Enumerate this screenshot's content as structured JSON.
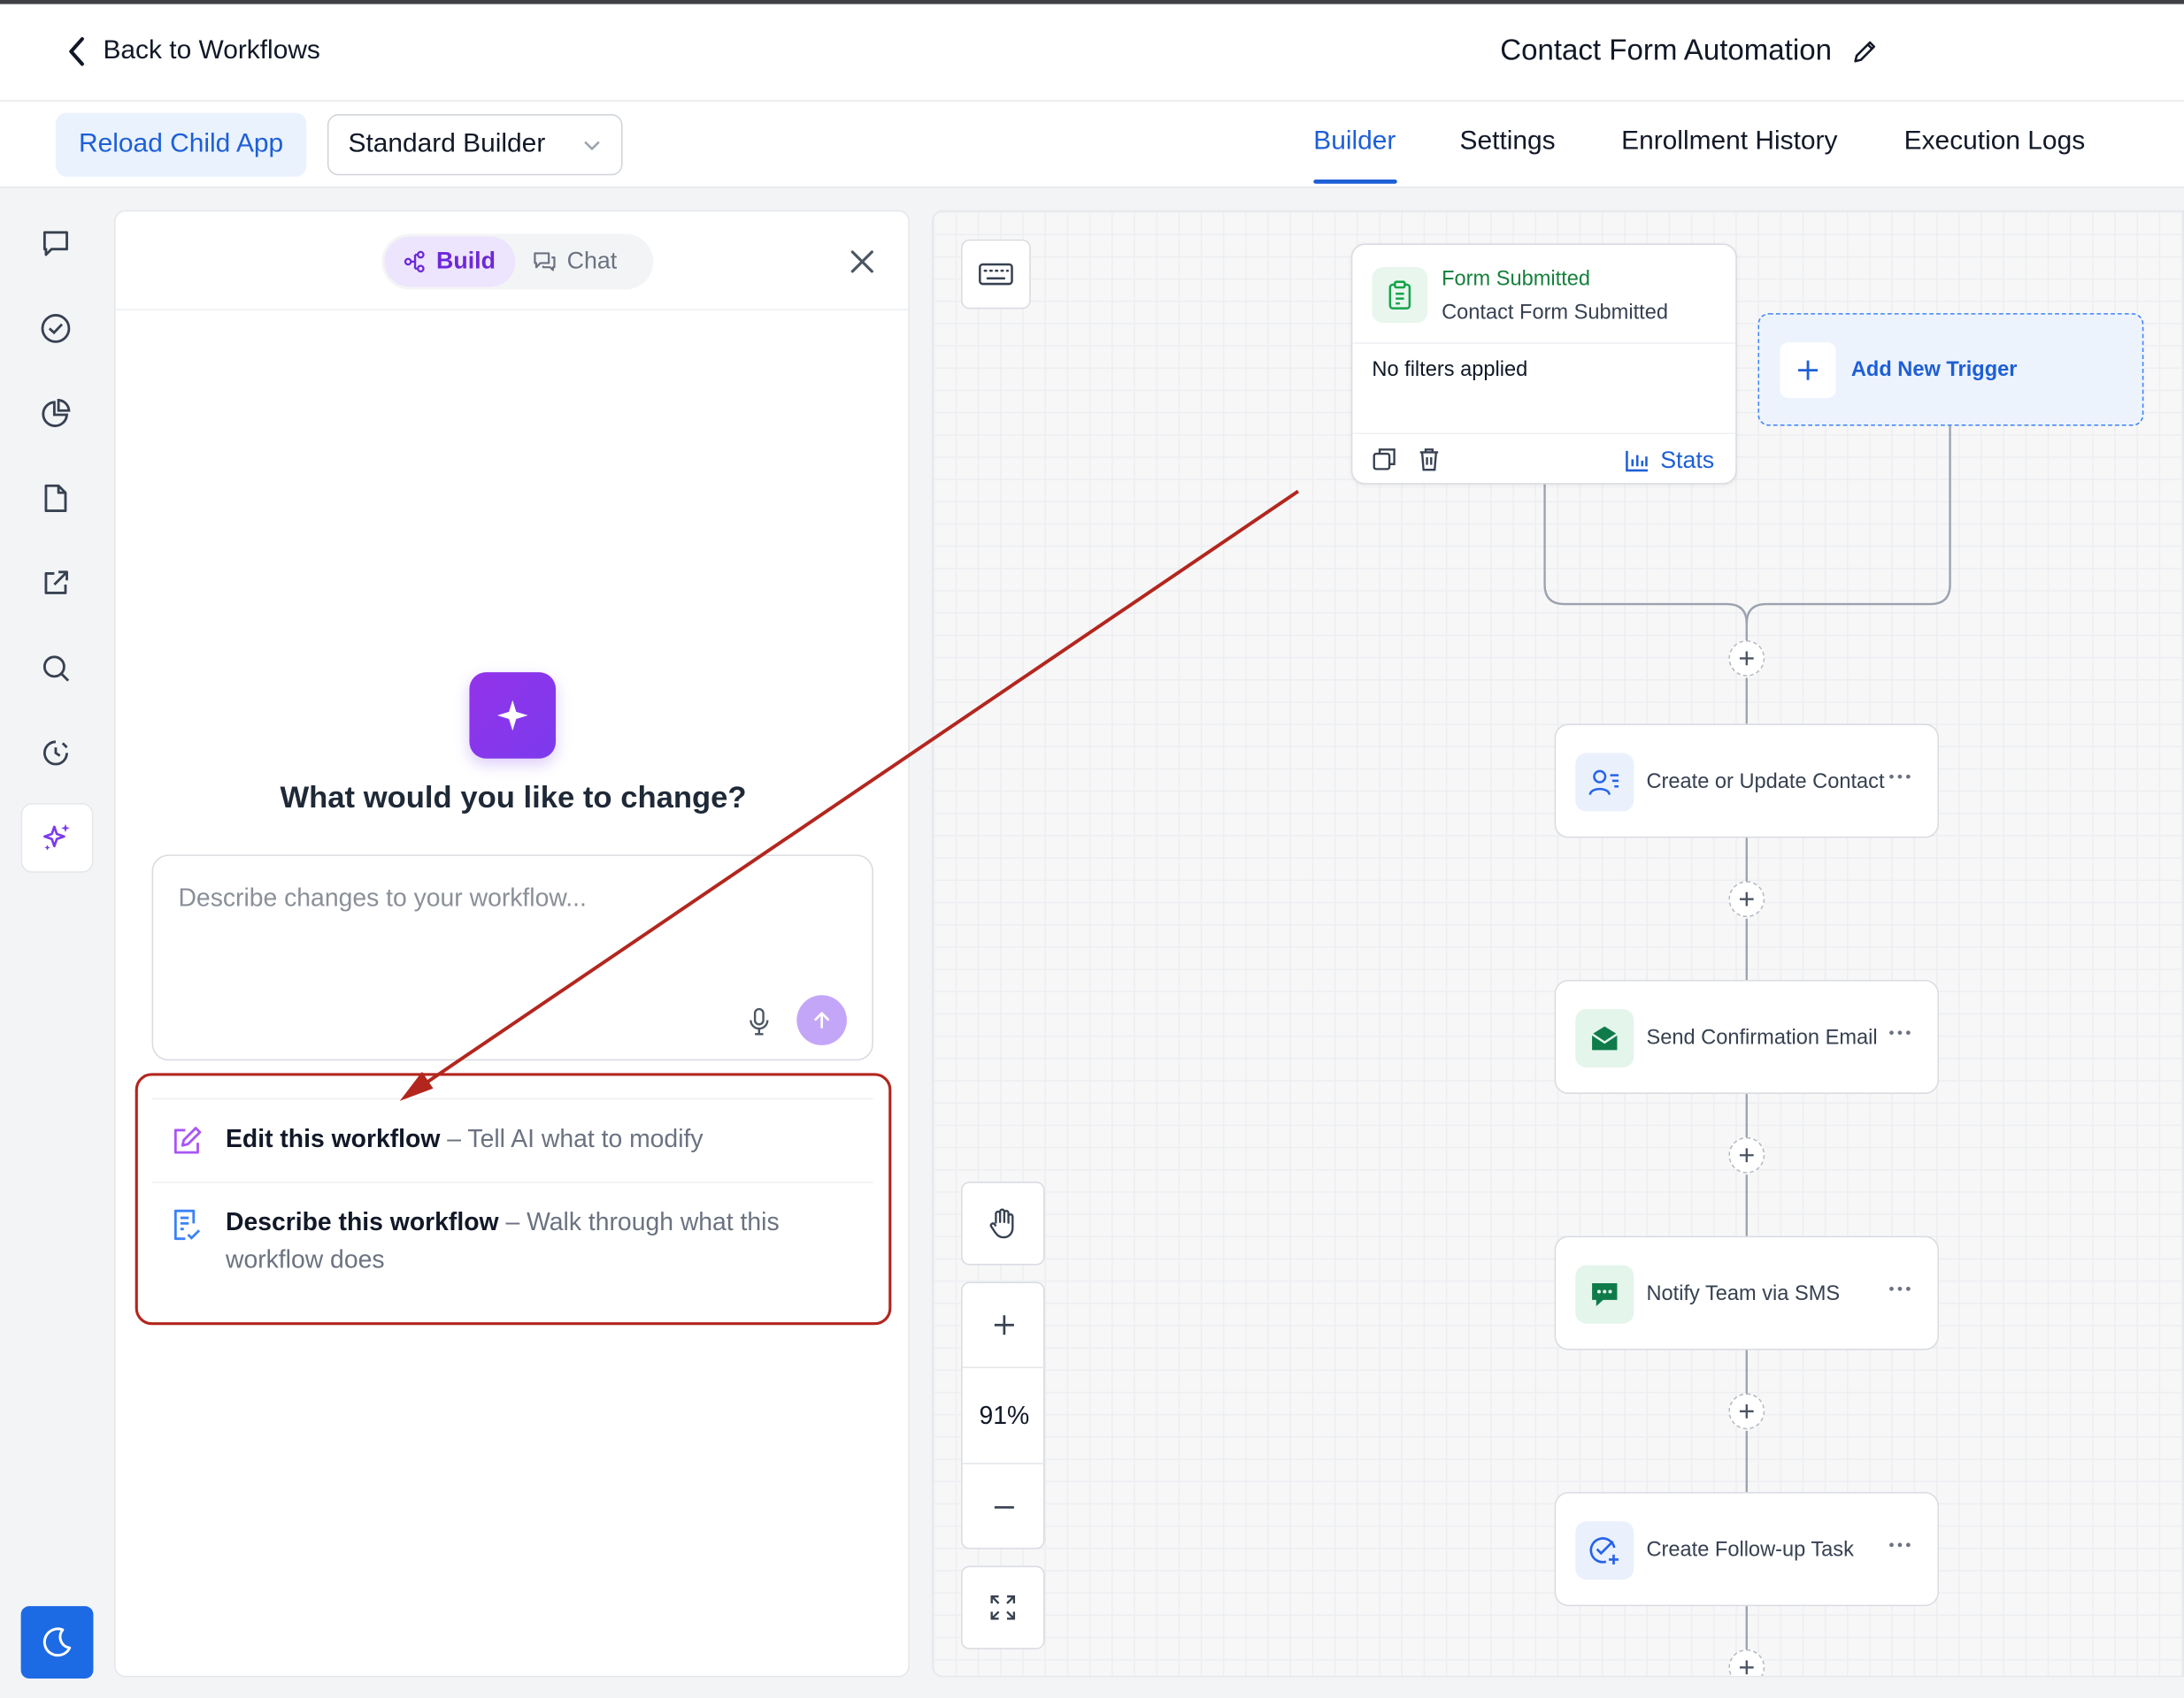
{
  "header": {
    "back_label": "Back to Workflows",
    "workflow_title": "Contact Form Automation"
  },
  "toolbar": {
    "reload_label": "Reload Child App",
    "builder_select": "Standard Builder",
    "tabs": [
      {
        "label": "Builder",
        "active": true
      },
      {
        "label": "Settings",
        "active": false
      },
      {
        "label": "Enrollment History",
        "active": false
      },
      {
        "label": "Execution Logs",
        "active": false
      }
    ]
  },
  "sidebar": {
    "icons": [
      "chat-bubble-icon",
      "check-circle-icon",
      "pie-chart-icon",
      "document-icon",
      "external-link-icon",
      "search-icon",
      "history-icon",
      "ai-sparkles-icon"
    ],
    "theme_toggle_icon": "moon-icon"
  },
  "ai_panel": {
    "build_label": "Build",
    "chat_label": "Chat",
    "question": "What would you like to change?",
    "input_placeholder": "Describe changes to your workflow...",
    "suggestions": [
      {
        "title": "Edit this workflow",
        "desc": " – Tell AI what to modify"
      },
      {
        "title": "Describe this workflow",
        "desc": " – Walk through what this workflow does"
      }
    ]
  },
  "canvas": {
    "zoom_level": "91%",
    "trigger": {
      "type": "Form Submitted",
      "name": "Contact Form Submitted",
      "filters": "No filters applied",
      "stats_label": "Stats"
    },
    "add_trigger_label": "Add New Trigger",
    "actions": [
      {
        "label": "Create or Update Contact",
        "icon": "contact-icon"
      },
      {
        "label": "Send Confirmation Email",
        "icon": "email-icon"
      },
      {
        "label": "Notify Team via SMS",
        "icon": "sms-icon"
      },
      {
        "label": "Create Follow-up Task",
        "icon": "task-icon"
      }
    ]
  },
  "colors": {
    "accent_blue": "#1d5fd6",
    "accent_purple": "#7c3aed",
    "trigger_green": "#15803d",
    "annotation_red": "#b3261e"
  }
}
